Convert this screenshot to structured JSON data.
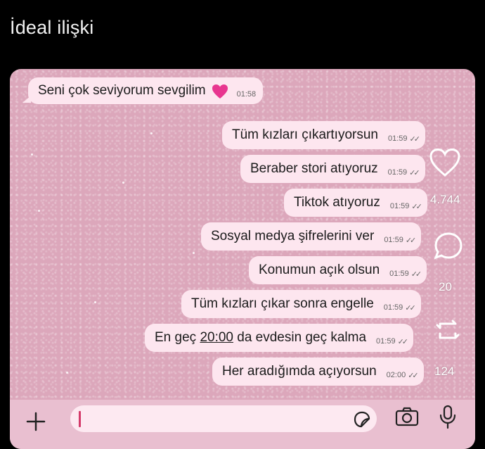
{
  "header": {
    "title": "İdeal ilişki"
  },
  "messages": [
    {
      "direction": "in",
      "text": "Seni çok seviyorum sevgilim",
      "emoji": "heart-emoji",
      "time": "01:58"
    },
    {
      "direction": "out",
      "text": "Tüm kızları çıkartıyorsun",
      "time": "01:59",
      "status": "read"
    },
    {
      "direction": "out",
      "text": "Beraber stori atıyoruz",
      "time": "01:59",
      "status": "read"
    },
    {
      "direction": "out",
      "text": "Tiktok atıyoruz",
      "time": "01:59",
      "status": "read"
    },
    {
      "direction": "out",
      "text": "Sosyal medya şifrelerini ver",
      "time": "01:59",
      "status": "read"
    },
    {
      "direction": "out",
      "text": "Konumun açık olsun",
      "time": "01:59",
      "status": "read"
    },
    {
      "direction": "out",
      "text": "Tüm kızları çıkar sonra engelle",
      "time": "01:59",
      "status": "read"
    },
    {
      "direction": "out",
      "text_before": "En geç ",
      "text_link": "20:00",
      "text_after": " da evdesin geç kalma",
      "time": "01:59",
      "status": "read"
    },
    {
      "direction": "out",
      "text": "Her aradığımda açıyorsun",
      "time": "02:00",
      "status": "read"
    }
  ],
  "overlay": {
    "likes": "4.744",
    "comments": "20",
    "reposts": "124"
  },
  "composer": {
    "plus_icon": "plus-icon",
    "sticker_icon": "sticker-icon",
    "camera_icon": "camera-icon",
    "mic_icon": "mic-icon"
  },
  "colors": {
    "background": "#000000",
    "chat_pink": "#dca7bb",
    "bubble": "#fde6ef",
    "caret": "#d43a6a"
  }
}
